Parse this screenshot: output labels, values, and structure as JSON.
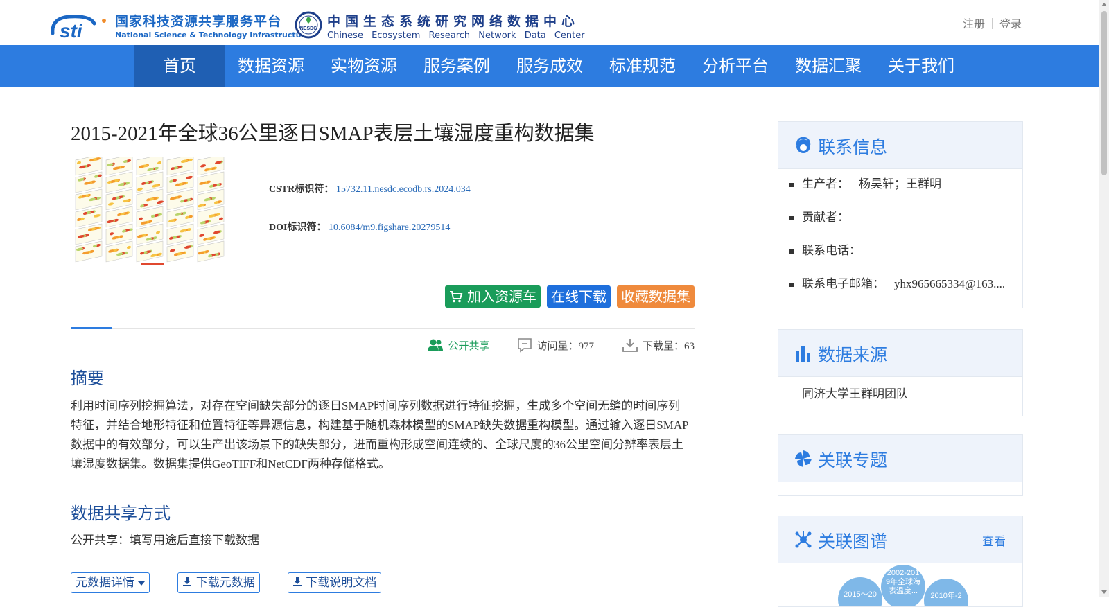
{
  "header": {
    "nsti_cn": "国家科技资源共享服务平台",
    "nsti_en": "National Science & Technology Infrastructure",
    "nesdc_badge": "NESDC",
    "nesdc_cn": "中国生态系统研究网络数据中心",
    "nesdc_en": "Chinese Ecosystem Research Network Data Center",
    "register": "注册",
    "login": "登录"
  },
  "nav": [
    "首页",
    "数据资源",
    "实物资源",
    "服务案例",
    "服务成效",
    "标准规范",
    "分析平台",
    "数据汇聚",
    "关于我们"
  ],
  "dataset": {
    "title": "2015-2021年全球36公里逐日SMAP表层土壤湿度重构数据集",
    "cstr_label": "CSTR标识符：",
    "cstr_value": "15732.11.nesdc.ecodb.rs.2024.034",
    "doi_label": "DOI标识符：",
    "doi_value": "10.6084/m9.figshare.20279514"
  },
  "actions": {
    "add_cart": "加入资源车",
    "download": "在线下载",
    "favorite": "收藏数据集"
  },
  "stats": {
    "share": "公开共享",
    "visits": "访问量：977",
    "downloads": "下载量：63"
  },
  "abstract": {
    "heading": "摘要",
    "text": "利用时间序列挖掘算法，对存在空间缺失部分的逐日SMAP时间序列数据进行特征挖掘，生成多个空间无缝的时间序列特征，并结合地形特征和位置特征等异源信息，构建基于随机森林模型的SMAP缺失数据重构模型。通过输入逐日SMAP数据中的有效部分，可以生产出该场景下的缺失部分，进而重构形成空间连续的、全球尺度的36公里空间分辨率表层土壤湿度数据集。数据集提供GeoTIFF和NetCDF两种存储格式。"
  },
  "sharing": {
    "heading": "数据共享方式",
    "text": "公开共享：填写用途后直接下载数据"
  },
  "links": {
    "metadata": "元数据详情",
    "download_meta": "下载元数据",
    "download_doc": "下载说明文档"
  },
  "sidebar": {
    "contact": {
      "title": "联系信息",
      "producer_label": "生产者：",
      "producer_value": "杨昊轩；王群明",
      "contributor_label": "贡献者：",
      "phone_label": "联系电话：",
      "email_label": "联系电子邮箱：",
      "email_value": "yhx965665334@163...."
    },
    "source": {
      "title": "数据来源",
      "value": "同济大学王群明团队"
    },
    "topic": {
      "title": "关联专题"
    },
    "graph": {
      "title": "关联图谱",
      "more": "查看",
      "node1": "2015～20",
      "node2": "2002-201",
      "node2b": "9年全球海",
      "node2c": "表温度...",
      "node3": "2010年-2"
    }
  },
  "colors": {
    "nav_bg": "#2d7ce0",
    "nav_active": "#1f5fb3",
    "green_btn": "#1a9c5a",
    "blue_btn": "#1e6fdc",
    "orange_btn": "#ef8a3c",
    "heading_blue": "#1e4f9a"
  }
}
